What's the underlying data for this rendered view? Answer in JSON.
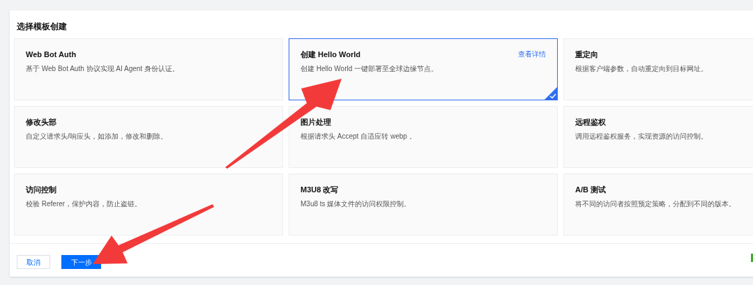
{
  "section_title": "选择模板创建",
  "templates": [
    {
      "title": "Web Bot Auth",
      "description": "基于 Web Bot Auth 协议实现 AI Agent 身份认证。",
      "selected": false
    },
    {
      "title": "创建 Hello World",
      "description": "创建 Hello World 一键部署至全球边缘节点。",
      "selected": true,
      "link": "查看详情"
    },
    {
      "title": "重定向",
      "description": "根据客户端参数，自动重定向到目标网址。",
      "selected": false
    },
    {
      "title": "修改头部",
      "description": "自定义请求头/响应头，如添加，修改和删除。",
      "selected": false
    },
    {
      "title": "图片处理",
      "description": "根据请求头 Accept 自适应转 webp 。",
      "selected": false
    },
    {
      "title": "远程鉴权",
      "description": "调用远程鉴权服务，实现资源的访问控制。",
      "selected": false
    },
    {
      "title": "访问控制",
      "description": "校验 Referer，保护内容，防止盗链。",
      "selected": false
    },
    {
      "title": "M3U8 改写",
      "description": "M3u8 ts 媒体文件的访问权限控制。",
      "selected": false
    },
    {
      "title": "A/B 测试",
      "description": "将不同的访问者按照预定策略，分配到不同的版本。",
      "selected": false
    }
  ],
  "buttons": [
    {
      "label": "取消",
      "kind": "secondary"
    },
    {
      "label": "下一步",
      "kind": "primary"
    }
  ]
}
